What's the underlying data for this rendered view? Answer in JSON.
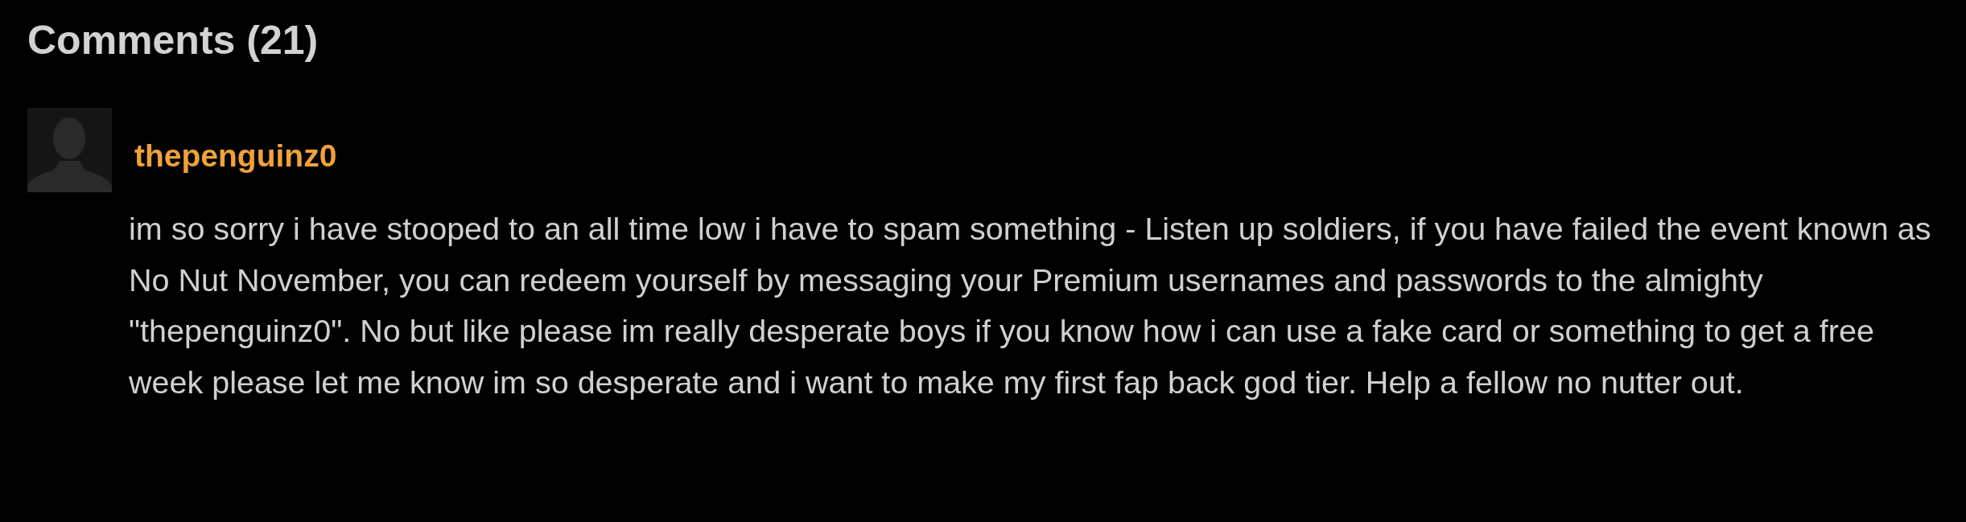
{
  "heading": "Comments (21)",
  "comments": [
    {
      "username": "thepenguinz0",
      "text": "im so sorry i have stooped to an all time low i have to spam something - Listen up soldiers, if you have failed the event known as No Nut November, you can redeem yourself by messaging your Premium usernames and passwords to the almighty \"thepenguinz0\". No but like please im really desperate boys if you know how i can use a fake card or something to get a free week please let me know im so desperate and i want to make my first fap back god tier. Help a fellow no nutter out."
    }
  ]
}
